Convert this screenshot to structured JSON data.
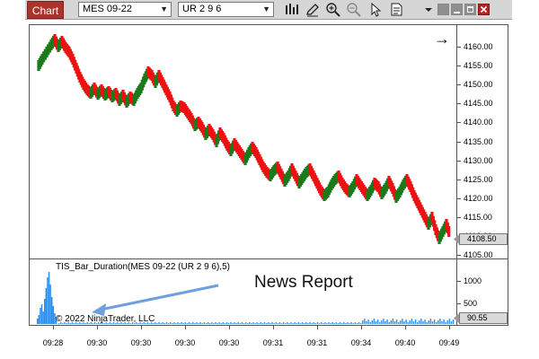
{
  "window": {
    "tab_label": "Chart",
    "instrument": "MES 09-22",
    "bar_type": "UR 2 9 6",
    "icons": [
      "bar-style-icon",
      "draw-pencil-icon",
      "zoom-in-icon",
      "zoom-out-icon",
      "pointer-icon",
      "properties-icon",
      "menu-dropdown-icon",
      "tile-icon",
      "minimize-icon",
      "maximize-icon",
      "close-icon"
    ]
  },
  "price_pane": {
    "direction_arrow": "→",
    "y_ticks": [
      "4160.00",
      "4155.00",
      "4150.00",
      "4145.00",
      "4140.00",
      "4135.00",
      "4130.00",
      "4125.00",
      "4120.00",
      "4115.00",
      "4110.00",
      "4105.00"
    ],
    "last_price": "4108.50",
    "up_color": "#1a7a1a",
    "down_color": "#ee1111"
  },
  "indicator_pane": {
    "title": "TIS_Bar_Duration(MES 09-22 (UR 2 9 6),5)",
    "y_ticks": [
      "1000",
      "500"
    ],
    "last_value": "90.55",
    "bar_color": "#2b8ff0"
  },
  "annotation": {
    "text": "News Report",
    "arrow_color": "#6e9fe0"
  },
  "copyright": "© 2022 NinjaTrader, LLC",
  "time_axis": [
    "09:28",
    "09:30",
    "09:30",
    "09:30",
    "09:30",
    "09:31",
    "09:31",
    "09:34",
    "09:40",
    "09:49"
  ]
}
